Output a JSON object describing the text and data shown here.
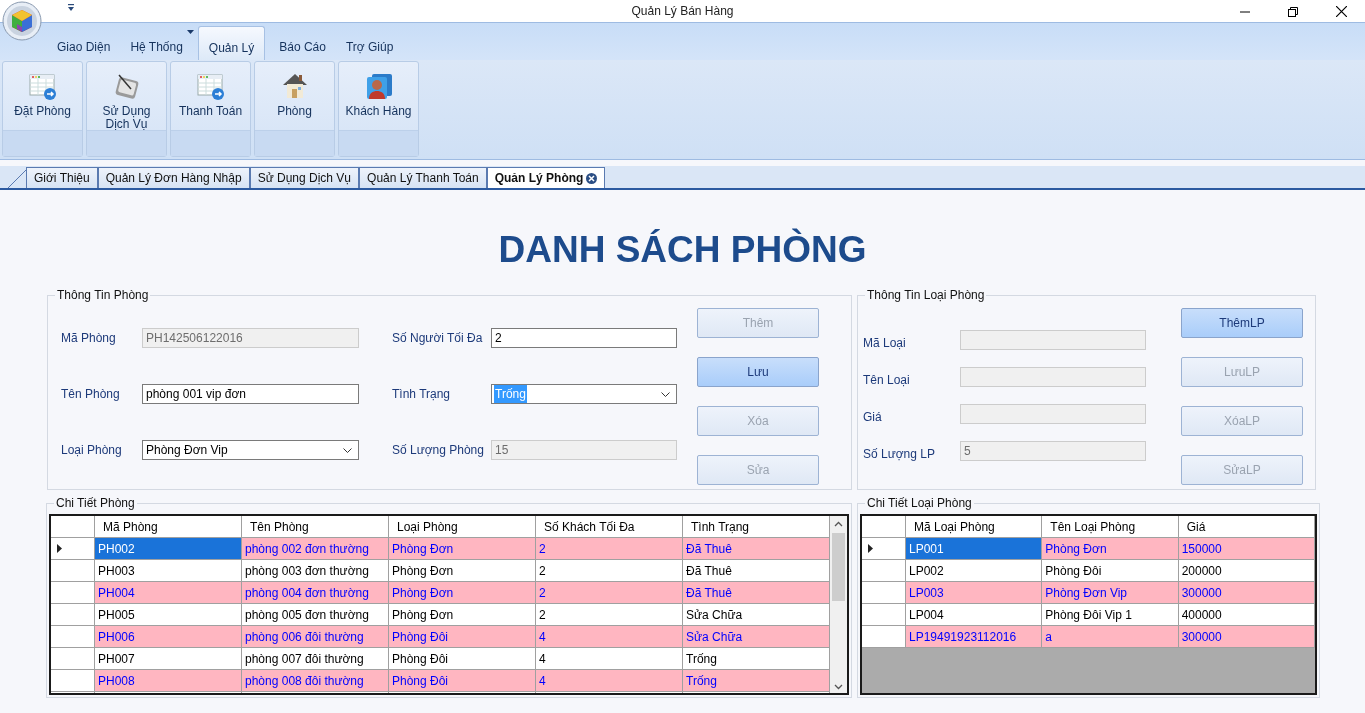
{
  "window": {
    "title": "Quản Lý Bán Hàng"
  },
  "ribbon": {
    "tabs": [
      {
        "label": "Giao Diện",
        "selected": false
      },
      {
        "label": "Hệ Thống",
        "selected": false
      },
      {
        "label": "Quản Lý",
        "selected": true
      },
      {
        "label": "Báo Cáo",
        "selected": false
      },
      {
        "label": "Trợ Giúp",
        "selected": false
      }
    ],
    "buttons": [
      {
        "label": "Đặt Phòng",
        "kind": "sheet"
      },
      {
        "label": "Sử Dụng Dịch Vụ",
        "kind": "tablet"
      },
      {
        "label": "Thanh Toán",
        "kind": "sheet"
      },
      {
        "label": "Phòng",
        "kind": "house"
      },
      {
        "label": "Khách Hàng",
        "kind": "person"
      }
    ]
  },
  "doc_tabs": [
    {
      "label": "Giới Thiệu",
      "selected": false
    },
    {
      "label": "Quản Lý Đơn Hàng Nhập",
      "selected": false
    },
    {
      "label": "Sử Dụng Dịch Vụ",
      "selected": false
    },
    {
      "label": "Quản Lý Thanh Toán",
      "selected": false
    },
    {
      "label": "Quản Lý Phòng",
      "selected": true
    }
  ],
  "heading": "DANH SÁCH PHÒNG",
  "room_info": {
    "title": "Thông Tin Phòng",
    "fields": [
      {
        "label": "Mã Phòng",
        "kind": "text",
        "value": "PH142506122016",
        "disabled": true
      },
      {
        "label": "Số Người Tối Đa",
        "kind": "text",
        "value": "2",
        "disabled": false
      },
      {
        "label": "Tên Phòng",
        "kind": "text",
        "value": "phòng 001 vip đơn",
        "disabled": false
      },
      {
        "label": "Tình Trạng",
        "kind": "combo",
        "value": "Trống",
        "disabled": false,
        "value_selected": true
      },
      {
        "label": "Loại Phòng",
        "kind": "combo",
        "value": "Phòng Đơn Vip",
        "disabled": false,
        "value_selected": false
      },
      {
        "label": "Số Lượng Phòng",
        "kind": "text",
        "value": "15",
        "disabled": true
      }
    ],
    "buttons": [
      {
        "label": "Thêm",
        "disabled": true
      },
      {
        "label": "Lưu",
        "disabled": false
      },
      {
        "label": "Xóa",
        "disabled": true
      },
      {
        "label": "Sửa",
        "disabled": true
      }
    ]
  },
  "room_type_info": {
    "title": "Thông Tin Loại Phòng",
    "fields": [
      {
        "label": "Mã Loại",
        "kind": "text",
        "disabled": true
      },
      {
        "label": "Tên Loại",
        "kind": "text",
        "disabled": true
      },
      {
        "label": "Giá",
        "kind": "text",
        "disabled": true
      },
      {
        "label": "Số Lượng LP",
        "kind": "text",
        "value": "5",
        "disabled": true
      }
    ],
    "buttons": [
      {
        "label": "ThêmLP",
        "disabled": false
      },
      {
        "label": "LưuLP",
        "disabled": true
      },
      {
        "label": "XóaLP",
        "disabled": true
      },
      {
        "label": "SửaLP",
        "disabled": true
      }
    ]
  },
  "room_table": {
    "title": "Chi Tiết Phòng",
    "columns": [
      "Mã Phòng",
      "Tên Phòng",
      "Loại Phòng",
      "Số Khách Tối Đa",
      "Tình Trạng"
    ],
    "rows": [
      {
        "cells": [
          "PH002",
          "phòng 002 đơn thường",
          "Phòng Đơn",
          "2",
          "Đã Thuê"
        ],
        "highlighted": true,
        "selected": true
      },
      {
        "cells": [
          "PH003",
          "phòng 003 đơn thường",
          "Phòng Đơn",
          "2",
          "Đã Thuê"
        ],
        "highlighted": false,
        "selected": false
      },
      {
        "cells": [
          "PH004",
          "phòng 004 đơn thường",
          "Phòng Đơn",
          "2",
          "Đã Thuê"
        ],
        "highlighted": true,
        "selected": false
      },
      {
        "cells": [
          "PH005",
          "phòng 005 đơn thường",
          "Phòng Đơn",
          "2",
          "Sửa Chữa"
        ],
        "highlighted": false,
        "selected": false
      },
      {
        "cells": [
          "PH006",
          "phòng 006 đôi thường",
          "Phòng Đôi",
          "4",
          "Sửa Chữa"
        ],
        "highlighted": true,
        "selected": false
      },
      {
        "cells": [
          "PH007",
          "phòng 007 đôi thường",
          "Phòng Đôi",
          "4",
          "Trống"
        ],
        "highlighted": false,
        "selected": false
      },
      {
        "cells": [
          "PH008",
          "phòng 008 đôi thường",
          "Phòng Đôi",
          "4",
          "Trống"
        ],
        "highlighted": true,
        "selected": false
      }
    ]
  },
  "room_type_table": {
    "title": "Chi Tiết Loại Phòng",
    "columns": [
      "Mã Loại Phòng",
      "Tên Loại Phòng",
      "Giá"
    ],
    "rows": [
      {
        "cells": [
          "LP001",
          "Phòng Đơn",
          "150000"
        ],
        "highlighted": true,
        "selected": true
      },
      {
        "cells": [
          "LP002",
          "Phòng Đôi",
          "200000"
        ],
        "highlighted": false,
        "selected": false
      },
      {
        "cells": [
          "LP003",
          "Phòng Đơn Vip",
          "300000"
        ],
        "highlighted": true,
        "selected": false
      },
      {
        "cells": [
          "LP004",
          "Phòng Đôi Vip 1",
          "400000"
        ],
        "highlighted": false,
        "selected": false
      },
      {
        "cells": [
          "LP19491923112016",
          "a",
          "300000"
        ],
        "highlighted": true,
        "selected": false
      }
    ]
  }
}
